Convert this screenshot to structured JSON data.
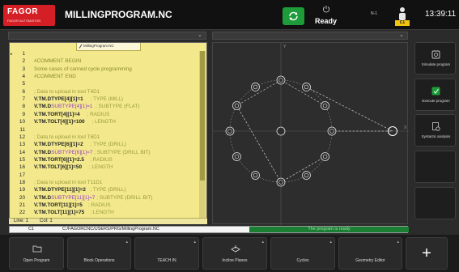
{
  "header": {
    "logo_text": "FAGOR",
    "logo_sub": "FAGOR AUTOMATION",
    "program_name": "MILLINGPROGRAM.NC",
    "status": "Ready",
    "channel_n": "N-1",
    "channel": "C1",
    "clock": "13:39:11"
  },
  "editor": {
    "tab_title": "MillingProgram.NC",
    "status_line": "Line: 1",
    "status_col": "Col: 1",
    "lines": [
      {
        "n": "1",
        "segs": [
          {
            "t": "",
            "c": "c-num"
          }
        ]
      },
      {
        "n": "2",
        "segs": [
          {
            "t": "#COMMENT BEGIN",
            "c": "c-comment"
          }
        ]
      },
      {
        "n": "3",
        "segs": [
          {
            "t": "Some cases of canned cycle programming",
            "c": "c-comment"
          }
        ]
      },
      {
        "n": "4",
        "segs": [
          {
            "t": "#COMMENT END",
            "c": "c-comment"
          }
        ]
      },
      {
        "n": "5",
        "segs": [
          {
            "t": "",
            "c": "c-num"
          }
        ]
      },
      {
        "n": "6",
        "segs": [
          {
            "t": "; Data to upload in tool T4D1",
            "c": "c-cm"
          }
        ]
      },
      {
        "n": "7",
        "segs": [
          {
            "t": "V.TM.DTYPE[4][1]=1",
            "c": "c-kw"
          },
          {
            "t": "     ; TYPE (MILL)",
            "c": "c-cm"
          }
        ]
      },
      {
        "n": "8",
        "segs": [
          {
            "t": "V.TM.D",
            "c": "c-kw"
          },
          {
            "t": "SUBTYPE[4][1]=1",
            "c": "c-purple"
          },
          {
            "t": "  ; SUBTYPE (FLAT)",
            "c": "c-cm"
          }
        ]
      },
      {
        "n": "9",
        "segs": [
          {
            "t": "V.TM.TORT[4][1]=4",
            "c": "c-kw"
          },
          {
            "t": "     ; RADIUS",
            "c": "c-cm"
          }
        ]
      },
      {
        "n": "10",
        "segs": [
          {
            "t": "V.TM.TOLT[4][1]=100",
            "c": "c-kw"
          },
          {
            "t": "     ; LENGTH",
            "c": "c-cm"
          }
        ]
      },
      {
        "n": "11",
        "segs": [
          {
            "t": "",
            "c": "c-num"
          }
        ]
      },
      {
        "n": "12",
        "segs": [
          {
            "t": "; Data to upload in tool T6D1",
            "c": "c-cm"
          }
        ]
      },
      {
        "n": "13",
        "segs": [
          {
            "t": "V.TM.DTYPE[6][1]=2",
            "c": "c-kw"
          },
          {
            "t": "     ; TYPE (DRILL)",
            "c": "c-cm"
          }
        ]
      },
      {
        "n": "14",
        "segs": [
          {
            "t": "V.TM.D",
            "c": "c-kw"
          },
          {
            "t": "SUBTYPE[6][1]=7",
            "c": "c-purple"
          },
          {
            "t": " ; SUBTYPE (DRILL BIT)",
            "c": "c-cm"
          }
        ]
      },
      {
        "n": "15",
        "segs": [
          {
            "t": "V.TM.TORT[6][1]=2.5",
            "c": "c-kw"
          },
          {
            "t": "    ; RADIUS",
            "c": "c-cm"
          }
        ]
      },
      {
        "n": "16",
        "segs": [
          {
            "t": "V.TM.TOLT[6][1]=50",
            "c": "c-kw"
          },
          {
            "t": "     ; LENGTH",
            "c": "c-cm"
          }
        ]
      },
      {
        "n": "17",
        "segs": [
          {
            "t": "",
            "c": "c-num"
          }
        ]
      },
      {
        "n": "18",
        "segs": [
          {
            "t": "; Data to upload in tool T11D1",
            "c": "c-cm"
          }
        ]
      },
      {
        "n": "19",
        "segs": [
          {
            "t": "V.TM.DTYPE[11][1]=2",
            "c": "c-kw"
          },
          {
            "t": "   ; TYPE (DRILL)",
            "c": "c-cm"
          }
        ]
      },
      {
        "n": "20",
        "segs": [
          {
            "t": "V.TM.D",
            "c": "c-kw"
          },
          {
            "t": "SUBTYPE[11][1]=7",
            "c": "c-purple"
          },
          {
            "t": " ; SUBTYPE (DRILL BIT)",
            "c": "c-cm"
          }
        ]
      },
      {
        "n": "21",
        "segs": [
          {
            "t": "V.TM.TORT[11][1]=5",
            "c": "c-kw"
          },
          {
            "t": "    ; RADIUS",
            "c": "c-cm"
          }
        ]
      },
      {
        "n": "22",
        "segs": [
          {
            "t": "V.TM.TOLT[11][1]=75",
            "c": "c-kw"
          },
          {
            "t": "    ; LENGTH",
            "c": "c-cm"
          }
        ]
      }
    ]
  },
  "graphic": {
    "axis_x": "X",
    "axis_y": "Y"
  },
  "sidekeys": [
    {
      "id": "simulate",
      "label": "Simulate program",
      "icon": "simulate-icon"
    },
    {
      "id": "execute",
      "label": "Execute program",
      "icon": "execute-icon"
    },
    {
      "id": "syntactic",
      "label": "Syntactic analysis",
      "icon": "syntax-icon"
    },
    {
      "id": "empty1",
      "label": "",
      "icon": ""
    },
    {
      "id": "empty2",
      "label": "",
      "icon": ""
    }
  ],
  "pathbar": {
    "channel": "C1",
    "path": "C:/FAGORCNC/USERS/PRG/MillingProgram.NC",
    "progress_text": "The program is ready"
  },
  "softkeys": [
    {
      "id": "open-program",
      "label": "Open Program",
      "icon": "folder-icon"
    },
    {
      "id": "block-operations",
      "label": "Block Operations",
      "icon": ""
    },
    {
      "id": "teach-in",
      "label": "TEACH IN",
      "icon": ""
    },
    {
      "id": "incline-planes",
      "label": "Incline Planes",
      "icon": "plane-icon"
    },
    {
      "id": "cycles",
      "label": "Cycles",
      "icon": ""
    },
    {
      "id": "geometry-editor",
      "label": "Geometry Editor",
      "icon": ""
    },
    {
      "id": "more",
      "label": "+",
      "icon": "plus-icon"
    }
  ],
  "colors": {
    "accent_red": "#d51f26",
    "ready_green": "#1e9c3a",
    "editor_bg": "#f3e98c",
    "progress_green": "#1a7f32",
    "channel_yellow": "#f1c40f"
  }
}
